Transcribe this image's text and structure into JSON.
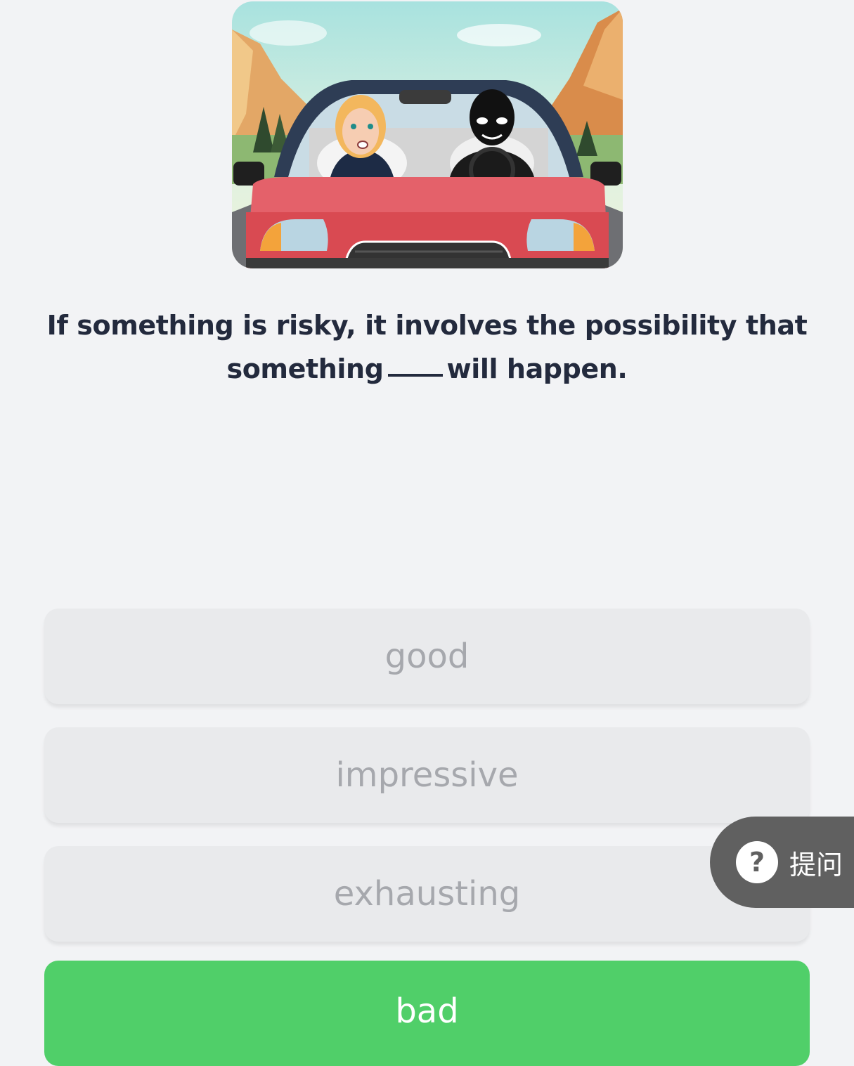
{
  "illustration": {
    "name": "car-scene-illustration"
  },
  "question": {
    "line1": "If something is risky, it involves the possibility that",
    "line2_before": "something",
    "line2_after": "will happen."
  },
  "options": [
    {
      "label": "good",
      "state": "default"
    },
    {
      "label": "impressive",
      "state": "default"
    },
    {
      "label": "exhausting",
      "state": "default"
    },
    {
      "label": "bad",
      "state": "correct"
    }
  ],
  "ask_button": {
    "icon": "question-mark-icon",
    "label": "提问"
  },
  "colors": {
    "background": "#f2f3f5",
    "question_text": "#232a3d",
    "option_bg": "#e9eaec",
    "option_text": "#a6a8ad",
    "correct_bg": "#50cf69",
    "ask_bg": "#606060"
  }
}
